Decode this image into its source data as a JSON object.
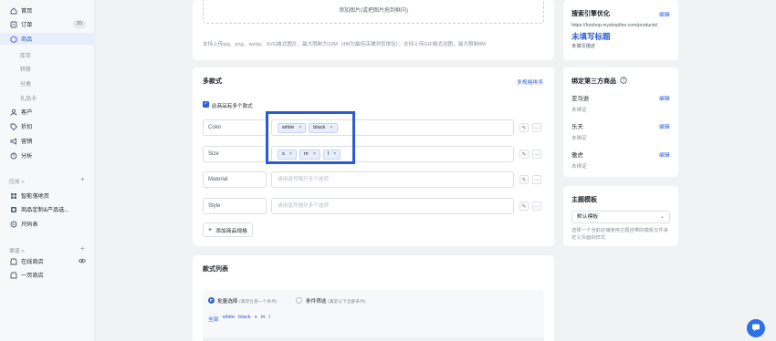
{
  "sidebar": {
    "items": [
      {
        "label": "首页",
        "icon": "home-icon"
      },
      {
        "label": "订单",
        "icon": "order-icon",
        "badge": "20"
      },
      {
        "label": "商品",
        "icon": "product-icon",
        "active": true
      }
    ],
    "product_sub": [
      "库存",
      "转移",
      "分类",
      "礼品卡"
    ],
    "items2": [
      {
        "label": "客户",
        "icon": "customer-icon"
      },
      {
        "label": "折扣",
        "icon": "discount-icon"
      },
      {
        "label": "营销",
        "icon": "marketing-icon"
      },
      {
        "label": "分析",
        "icon": "analytics-icon"
      }
    ],
    "apps_title": "应用 >",
    "apps": [
      {
        "label": "智能落地页",
        "icon": "landing-page-icon"
      },
      {
        "label": "商品定制&产品选...",
        "icon": "customize-icon"
      },
      {
        "label": "尺码表",
        "icon": "size-chart-icon"
      }
    ],
    "channels_title": "渠道 >",
    "channels": [
      {
        "label": "在线商店",
        "icon": "store-icon"
      },
      {
        "label": "一页商店",
        "icon": "one-page-store-icon"
      }
    ]
  },
  "upload": {
    "text": "添加图片(或把图片拖到框内)",
    "tip": "支持上传jpg、png、webp、SVG格式图片，最大限制为10M（4M为最佳店铺浏览体验）；支持上传GIF格式动图，最大限制8M"
  },
  "variants": {
    "title": "多款式",
    "sort_link": "多规格排序",
    "checkbox_label": "此商品有多个款式",
    "options": [
      {
        "name": "Color",
        "values": [
          "white",
          "black"
        ],
        "placeholder": ""
      },
      {
        "name": "Size",
        "values": [
          "s",
          "m",
          "l"
        ],
        "placeholder": ""
      },
      {
        "name": "Material",
        "values": [],
        "placeholder": "请用逗号隔开多个选项"
      },
      {
        "name": "Style",
        "values": [],
        "placeholder": "请用逗号隔开多个选项"
      }
    ],
    "add_button": "添加商品规格"
  },
  "variant_list": {
    "title": "款式列表",
    "radio1": "批量选择",
    "radio1_hint": "(满足任意一个条件)",
    "radio2": "条件筛选",
    "radio2_hint": "(满足以下全部条件)",
    "filters": [
      "全部",
      "white",
      "black",
      "s",
      "m",
      "l"
    ]
  },
  "seo": {
    "title": "搜索引擎优化",
    "edit": "编辑",
    "url": "https://hoshop.myshopline.com/products/",
    "page_title": "未填写标题",
    "desc": "未填写描述"
  },
  "third_party": {
    "title": "绑定第三方商品",
    "items": [
      {
        "name": "亚马逊",
        "status": "未绑定",
        "edit": "编辑"
      },
      {
        "name": "乐天",
        "status": "未绑定",
        "edit": "编辑"
      },
      {
        "name": "雅虎",
        "status": "未绑定",
        "edit": "编辑"
      }
    ]
  },
  "theme": {
    "title": "主题模板",
    "selected": "默认模板",
    "desc": "选择一个当前店铺使用主题自带的模板文件来定义页面的样式"
  },
  "colors": {
    "accent": "#2b5fd9",
    "highlight": "#2a5bd7",
    "chat": "#2b72e8"
  }
}
